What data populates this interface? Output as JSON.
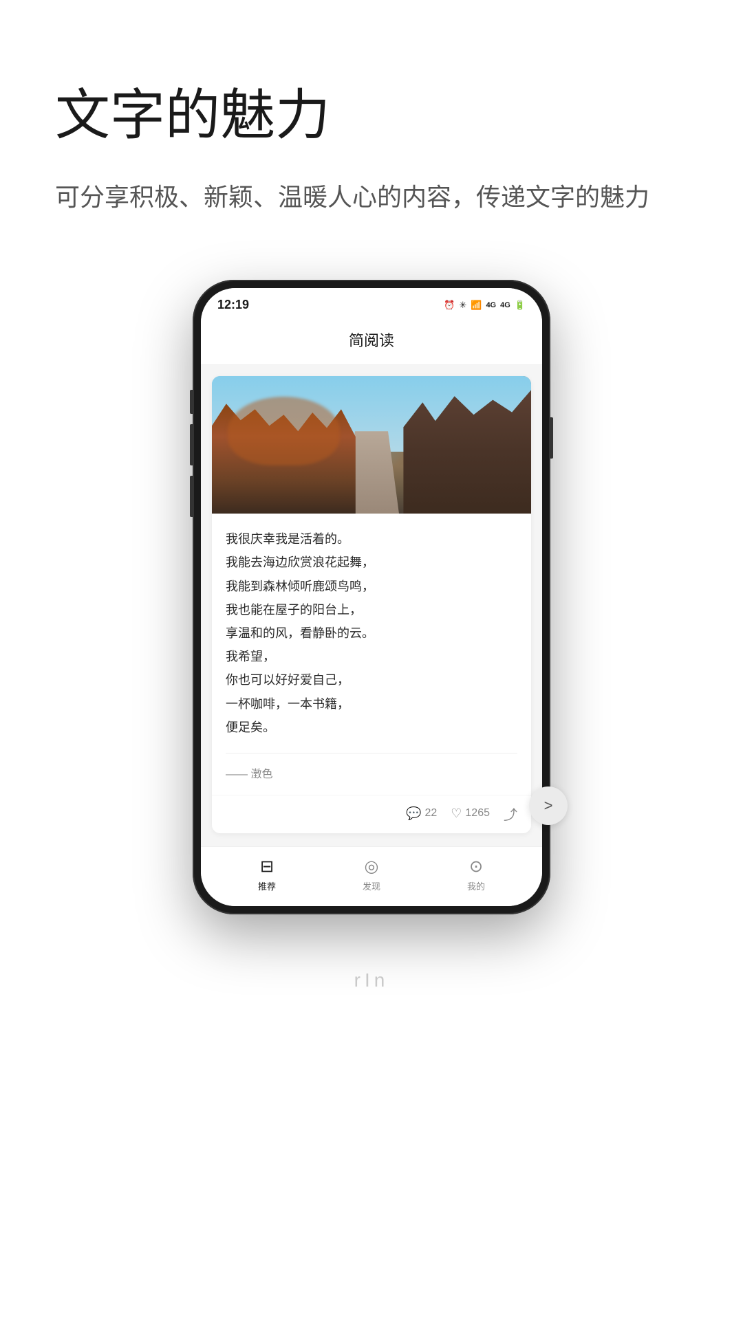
{
  "header": {
    "title": "文字的魅力",
    "subtitle": "可分享积极、新颖、温暖人心的内容，传递文字的魅力"
  },
  "phone": {
    "statusBar": {
      "time": "12:19",
      "nfcIcon": "N",
      "icons": "⏰ ✳ ❄ 📶 4G 4G 🔋"
    },
    "appTitle": "简阅读",
    "card": {
      "poem": [
        "我很庆幸我是活着的。",
        "我能去海边欣赏浪花起舞，",
        "我能到森林倾听鹿颂鸟鸣，",
        "我也能在屋子的阳台上，",
        "享温和的风，看静卧的云。",
        "我希望，",
        "你也可以好好爱自己，",
        "一杯咖啡，一本书籍，",
        "便足矣。"
      ],
      "author": "—— 澂色",
      "commentCount": "22",
      "likeCount": "1265"
    },
    "bottomNav": [
      {
        "label": "推荐",
        "icon": "🖥",
        "active": true
      },
      {
        "label": "发现",
        "icon": "🧭",
        "active": false
      },
      {
        "label": "我的",
        "icon": "👤",
        "active": false
      }
    ]
  },
  "arrowLabel": ">",
  "icons": {
    "comment": "💬",
    "like": "♡",
    "share": "↗"
  }
}
